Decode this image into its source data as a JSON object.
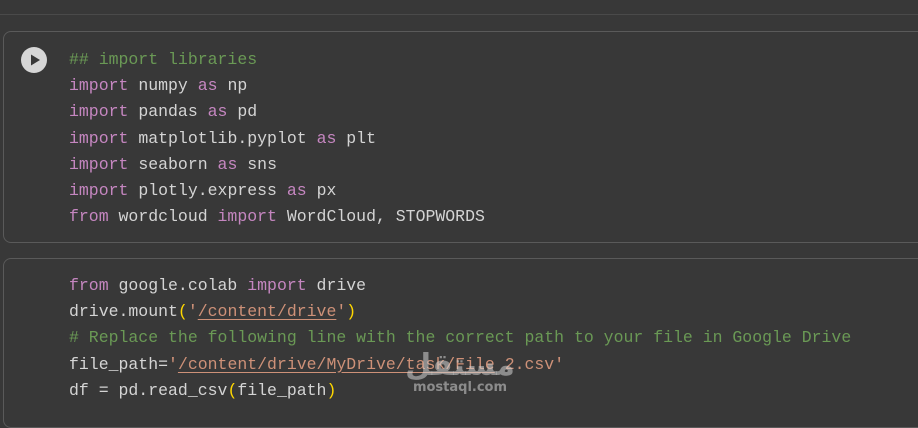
{
  "cells": [
    {
      "lines": [
        [
          {
            "t": "## import libraries",
            "c": "cm"
          }
        ],
        [
          {
            "t": "import",
            "c": "kw"
          },
          {
            "t": " numpy ",
            "c": "plain"
          },
          {
            "t": "as",
            "c": "kw"
          },
          {
            "t": " np",
            "c": "plain"
          }
        ],
        [
          {
            "t": "import",
            "c": "kw"
          },
          {
            "t": " pandas ",
            "c": "plain"
          },
          {
            "t": "as",
            "c": "kw"
          },
          {
            "t": " pd",
            "c": "plain"
          }
        ],
        [
          {
            "t": "import",
            "c": "kw"
          },
          {
            "t": " matplotlib.pyplot ",
            "c": "plain"
          },
          {
            "t": "as",
            "c": "kw"
          },
          {
            "t": " plt",
            "c": "plain"
          }
        ],
        [
          {
            "t": "import",
            "c": "kw"
          },
          {
            "t": " seaborn ",
            "c": "plain"
          },
          {
            "t": "as",
            "c": "kw"
          },
          {
            "t": " sns",
            "c": "plain"
          }
        ],
        [
          {
            "t": "import",
            "c": "kw"
          },
          {
            "t": " plotly.express ",
            "c": "plain"
          },
          {
            "t": "as",
            "c": "kw"
          },
          {
            "t": " px",
            "c": "plain"
          }
        ],
        [
          {
            "t": "from",
            "c": "kw"
          },
          {
            "t": " wordcloud ",
            "c": "plain"
          },
          {
            "t": "import",
            "c": "kw"
          },
          {
            "t": " WordCloud, STOPWORDS",
            "c": "plain"
          }
        ]
      ]
    },
    {
      "lines": [
        [
          {
            "t": "from",
            "c": "kw"
          },
          {
            "t": " google.colab ",
            "c": "plain"
          },
          {
            "t": "import",
            "c": "kw"
          },
          {
            "t": " drive",
            "c": "plain"
          }
        ],
        [
          {
            "t": "drive.mount",
            "c": "plain"
          },
          {
            "t": "(",
            "c": "paren"
          },
          {
            "t": "'",
            "c": "str"
          },
          {
            "t": "/content/drive",
            "c": "str path"
          },
          {
            "t": "'",
            "c": "str"
          },
          {
            "t": ")",
            "c": "paren"
          }
        ],
        [
          {
            "t": "# Replace the following line with the correct path to your file in Google Drive",
            "c": "cm"
          }
        ],
        [
          {
            "t": "file_path=",
            "c": "plain"
          },
          {
            "t": "'",
            "c": "str"
          },
          {
            "t": "/content/drive/MyDrive/task/File",
            "c": "str path"
          },
          {
            "t": " 2.csv'",
            "c": "str"
          }
        ],
        [
          {
            "t": "df = pd.read_csv",
            "c": "plain"
          },
          {
            "t": "(",
            "c": "paren"
          },
          {
            "t": "file_path",
            "c": "plain"
          },
          {
            "t": ")",
            "c": "paren"
          }
        ]
      ]
    }
  ],
  "run_button": {
    "icon": "play-icon",
    "fill": "#d6d6d6",
    "glyph": "#383838"
  },
  "watermark": {
    "logo": "مستقل",
    "text": "mostaql.com"
  },
  "colors": {
    "background": "#383838",
    "keyword": "#c586c0",
    "comment": "#6a9955",
    "string": "#ce9178",
    "bracket": "#ffd700",
    "text": "#d4d4d4"
  }
}
